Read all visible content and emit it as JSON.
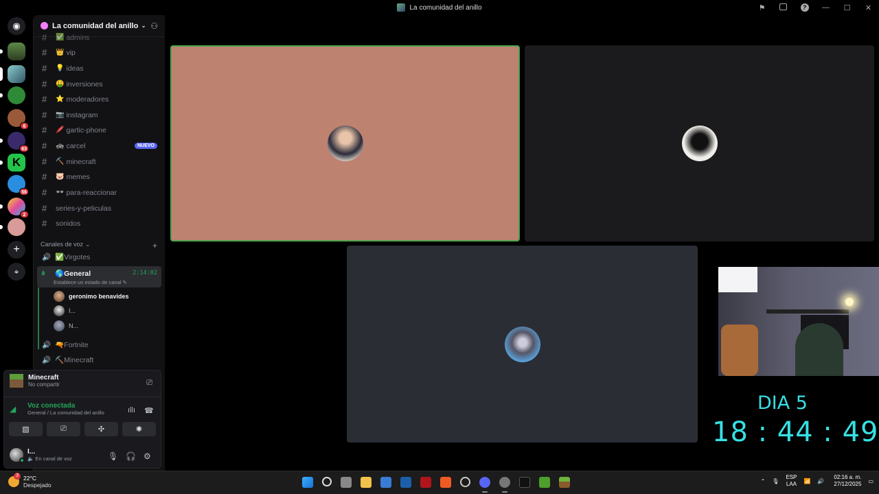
{
  "window": {
    "title": "La comunidad del anillo"
  },
  "server": {
    "name": "La comunidad del anillo"
  },
  "text_channels": [
    {
      "emoji": "✅",
      "name": "admins"
    },
    {
      "emoji": "👑",
      "name": "vip"
    },
    {
      "emoji": "💡",
      "name": "ideas"
    },
    {
      "emoji": "🤑",
      "name": "inversiones"
    },
    {
      "emoji": "⭐",
      "name": "moderadores"
    },
    {
      "emoji": "📷",
      "name": "instagram"
    },
    {
      "emoji": "🖍️",
      "name": "gartic-phone"
    },
    {
      "emoji": "🚓",
      "name": "carcel",
      "badge": "NUEVO"
    },
    {
      "emoji": "⛏️",
      "name": "minecraft"
    },
    {
      "emoji": "🐷",
      "name": "memes"
    },
    {
      "emoji": "👓",
      "name": "para-reaccionar"
    },
    {
      "emoji": "",
      "name": "series-y-peliculas"
    },
    {
      "emoji": "",
      "name": "sonidos"
    }
  ],
  "voice_category": "Canales de voz",
  "voice_channels": {
    "virgotes": {
      "emoji": "✅",
      "name": "Virgotes"
    },
    "general": {
      "emoji": "🌎",
      "name": "General",
      "timer": "2:14:02",
      "status": "Establece un estado de canal"
    },
    "users": [
      {
        "name": "geronimo benavides"
      },
      {
        "name": "I..."
      },
      {
        "name": "N..."
      }
    ],
    "fortnite": {
      "emoji": "🔫",
      "name": "Fortnite"
    },
    "minecraft": {
      "emoji": "⛏️",
      "name": "Minecraft"
    }
  },
  "server_badges": [
    "6",
    "63",
    "56",
    "2"
  ],
  "activity": {
    "game": "Minecraft",
    "subtitle": "No compartir"
  },
  "voice_status": {
    "title": "Voz conectada",
    "channel": "General / La comunidad del anillo"
  },
  "user": {
    "name": "I...",
    "status": "En canal de voz"
  },
  "overlay": {
    "day": "DIA 5",
    "time": "18 : 44 : 49"
  },
  "weather": {
    "temp": "22°C",
    "desc": "Despejado",
    "badge": "3"
  },
  "tray": {
    "lang1": "ESP",
    "lang2": "LAA",
    "time": "02:16 a. m.",
    "date": "27/12/2025"
  },
  "colors": {
    "accent": "#5865f2",
    "online": "#23a55a",
    "speaking": "#4fa34c",
    "overlay_text": "#37e0e3"
  }
}
